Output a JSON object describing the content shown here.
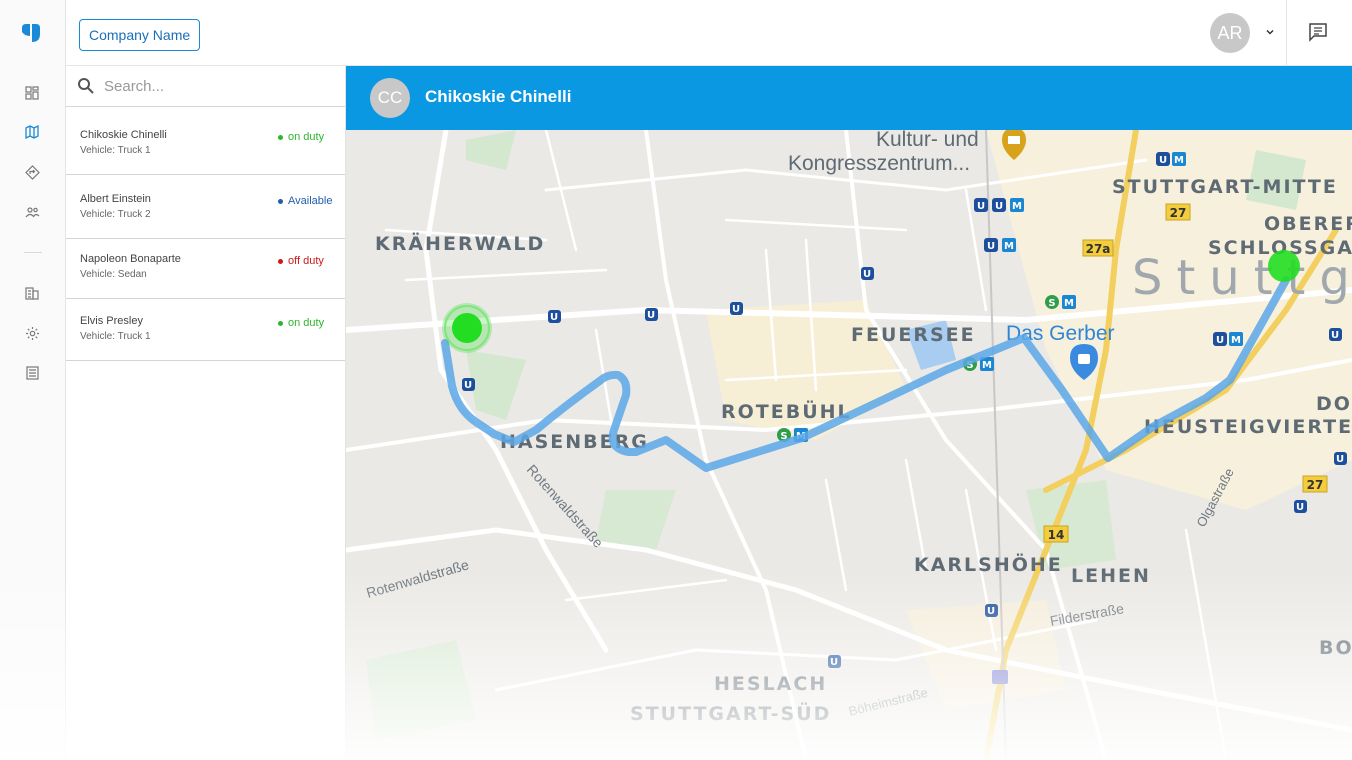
{
  "topbar": {
    "company_label": "Company Name",
    "user_initials": "AR"
  },
  "rail": {
    "icons": [
      "dashboard-icon",
      "map-icon",
      "directions-icon",
      "people-icon",
      "building-icon",
      "settings-icon",
      "list-icon"
    ],
    "active": "map-icon",
    "accent": "#1a8ad6"
  },
  "search": {
    "placeholder": "Search..."
  },
  "drivers": [
    {
      "name": "Chikoskie Chinelli",
      "vehicle": "Vehicle: Truck 1",
      "status": "on duty",
      "status_color": "#2db52d"
    },
    {
      "name": "Albert Einstein",
      "vehicle": "Vehicle: Truck 2",
      "status": "Available",
      "status_color": "#1f5fa8"
    },
    {
      "name": "Napoleon Bonaparte",
      "vehicle": "Vehicle: Sedan",
      "status": "off duty",
      "status_color": "#d01818"
    },
    {
      "name": "Elvis Presley",
      "vehicle": "Vehicle: Truck 1",
      "status": "on duty",
      "status_color": "#2db52d"
    }
  ],
  "map": {
    "header_initials": "CC",
    "header_name": "Chikoskie Chinelli",
    "header_color": "#0a98e3",
    "route_color": "#5aa7e8",
    "marker_color": "#22dd22",
    "labels": {
      "kultur1": "Kultur- und",
      "kultur2": "Kongresszentrum...",
      "stuttgart_mitte": "STUTTGART-MITTE",
      "oberer": "OBERER",
      "schlossgarten": "SCHLOSSGA",
      "kraeherwald": "KRÄHERWALD",
      "stuttgart": "Stuttga",
      "feuersee": "FEUERSEE",
      "gerber": "Das Gerber",
      "rotebuehl": "ROTEBÜHL",
      "hasenberg": "HASENBERG",
      "rotenwaldstrasse1": "Rotenwaldstraße",
      "rotenwaldstrasse2": "Rotenwaldstraße",
      "heusteig": "HEUSTEIGVIERTEL",
      "olgastrasse": "Olgastraße",
      "karlshoehe": "KARLSHÖHE",
      "lehen": "LEHEN",
      "filderstrasse": "Filderstraße",
      "heslach": "HESLACH",
      "stuttgart_sued": "STUTTGART-SÜD",
      "boeheimstrasse": "Böheimstraße",
      "do": "DO",
      "bo": "BO",
      "road27": "27",
      "road27a": "27a",
      "road14": "14"
    }
  }
}
